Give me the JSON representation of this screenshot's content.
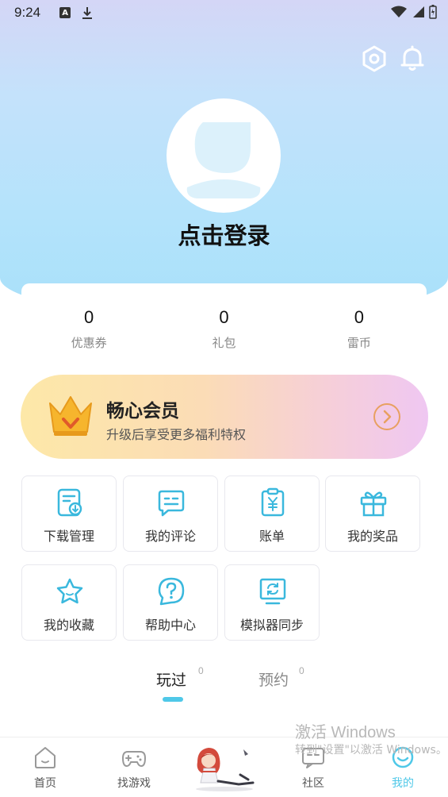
{
  "status_bar": {
    "time": "9:24",
    "a_badge": "A"
  },
  "header": {
    "icons": [
      "settings-hexagon-icon",
      "bell-icon"
    ],
    "login_label": "点击登录"
  },
  "stats": [
    {
      "value": "0",
      "label": "优惠券"
    },
    {
      "value": "0",
      "label": "礼包"
    },
    {
      "value": "0",
      "label": "雷币"
    }
  ],
  "vip": {
    "title": "畅心会员",
    "subtitle": "升级后享受更多福利特权",
    "icon": "crown-icon"
  },
  "grid": [
    {
      "label": "下载管理",
      "icon": "download-manage-icon"
    },
    {
      "label": "我的评论",
      "icon": "comment-icon"
    },
    {
      "label": "账单",
      "icon": "bill-icon"
    },
    {
      "label": "我的奖品",
      "icon": "gift-icon"
    },
    {
      "label": "我的收藏",
      "icon": "star-icon"
    },
    {
      "label": "帮助中心",
      "icon": "help-icon"
    },
    {
      "label": "模拟器同步",
      "icon": "emulator-sync-icon"
    }
  ],
  "tabs": [
    {
      "label": "玩过",
      "count": "0",
      "active": true
    },
    {
      "label": "预约",
      "count": "0",
      "active": false
    }
  ],
  "watermark": {
    "line1": "激活 Windows",
    "line2": "转到\"设置\"以激活 Windows。"
  },
  "bottom_nav": [
    {
      "label": "首页",
      "icon": "home-icon"
    },
    {
      "label": "找游戏",
      "icon": "gamepad-icon"
    },
    {
      "label": "社区",
      "icon": "community-icon"
    },
    {
      "label": "我的",
      "icon": "smiley-icon",
      "active": true
    }
  ],
  "colors": {
    "accent": "#4fc8e8",
    "icon_blue": "#3ab8dd",
    "vip_orange": "#e8a060"
  }
}
